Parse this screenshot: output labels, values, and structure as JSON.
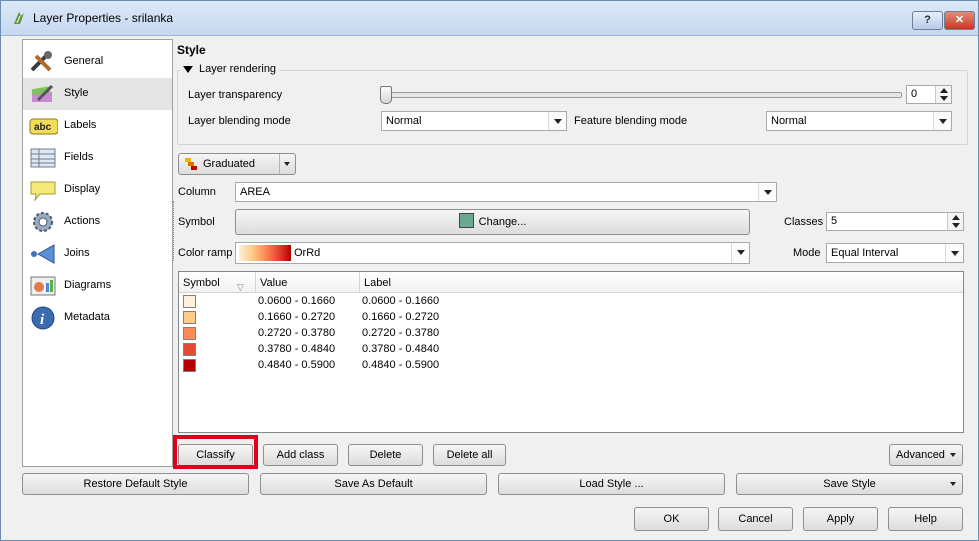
{
  "window": {
    "title": "Layer Properties - srilanka",
    "help_label": "?",
    "close_label": "✕"
  },
  "sidebar": {
    "items": [
      {
        "label": "General",
        "icon": "tools-icon"
      },
      {
        "label": "Style",
        "icon": "style-icon"
      },
      {
        "label": "Labels",
        "icon": "labels-abc-icon"
      },
      {
        "label": "Fields",
        "icon": "fields-table-icon"
      },
      {
        "label": "Display",
        "icon": "display-tooltip-icon"
      },
      {
        "label": "Actions",
        "icon": "actions-gear-icon"
      },
      {
        "label": "Joins",
        "icon": "joins-icon"
      },
      {
        "label": "Diagrams",
        "icon": "diagrams-icon"
      },
      {
        "label": "Metadata",
        "icon": "info-icon"
      }
    ],
    "selected": "Style"
  },
  "style": {
    "section_title": "Style",
    "layer_rendering": {
      "title": "Layer rendering",
      "transparency_label": "Layer transparency",
      "transparency_value": "0",
      "blending_label": "Layer blending mode",
      "blending_value": "Normal",
      "feature_blending_label": "Feature blending mode",
      "feature_blending_value": "Normal"
    },
    "renderer": "Graduated",
    "column_label": "Column",
    "column_value": "AREA",
    "symbol_label": "Symbol",
    "change_label": "Change...",
    "symbol_color": "#6aa88f",
    "classes_label": "Classes",
    "classes_value": "5",
    "color_ramp_label": "Color ramp",
    "color_ramp_value": "OrRd",
    "mode_label": "Mode",
    "mode_value": "Equal Interval"
  },
  "table": {
    "headers": [
      "Symbol",
      "Value",
      "Label"
    ],
    "rows": [
      {
        "color": "#fef0d9",
        "value": "0.0600 - 0.1660",
        "label": "0.0600 - 0.1660"
      },
      {
        "color": "#fdcc8a",
        "value": "0.1660 - 0.2720",
        "label": "0.1660 - 0.2720"
      },
      {
        "color": "#fc8d59",
        "value": "0.2720 - 0.3780",
        "label": "0.2720 - 0.3780"
      },
      {
        "color": "#e34a33",
        "value": "0.3780 - 0.4840",
        "label": "0.3780 - 0.4840"
      },
      {
        "color": "#b30000",
        "value": "0.4840 - 0.5900",
        "label": "0.4840 - 0.5900"
      }
    ]
  },
  "actions": {
    "classify": "Classify",
    "add_class": "Add class",
    "delete": "Delete",
    "delete_all": "Delete all",
    "advanced": "Advanced"
  },
  "footer": {
    "restore_default": "Restore Default Style",
    "save_as_default": "Save As Default",
    "load_style": "Load Style ...",
    "save_style": "Save Style",
    "ok": "OK",
    "cancel": "Cancel",
    "apply": "Apply",
    "help": "Help"
  }
}
